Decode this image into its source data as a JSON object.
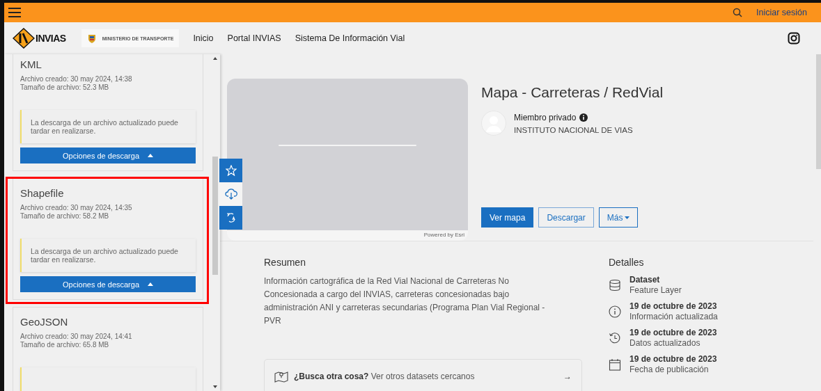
{
  "top_bar": {
    "sign_in": "Iniciar sesión"
  },
  "nav": {
    "logo_text": "INVIAS",
    "ministry": "MINISTERIO DE TRANSPORTE",
    "links": [
      "Inicio",
      "Portal INVIAS",
      "Sistema De Información Vial"
    ]
  },
  "downloads": [
    {
      "format": "KML",
      "created": "Archivo creado: 30 may 2024, 14:38",
      "size": "Tamaño de archivo: 52.3 MB",
      "notice": "La descarga de un archivo actualizado puede tardar en realizarse.",
      "button": "Opciones de descarga",
      "highlighted": false
    },
    {
      "format": "Shapefile",
      "created": "Archivo creado: 30 may 2024, 14:35",
      "size": "Tamaño de archivo: 58.2 MB",
      "notice": "La descarga de un archivo actualizado puede tardar en realizarse.",
      "button": "Opciones de descarga",
      "highlighted": true
    },
    {
      "format": "GeoJSON",
      "created": "Archivo creado: 30 may 2024, 14:41",
      "size": "Tamaño de archivo: 65.8 MB",
      "highlighted": false
    }
  ],
  "side_actions": [
    {
      "kind": "favorite",
      "selected": false
    },
    {
      "kind": "download",
      "selected": true
    },
    {
      "kind": "translate",
      "selected": false
    }
  ],
  "map": {
    "credit": "Powered by Esri"
  },
  "item": {
    "title": "Mapa - Carreteras / RedVial",
    "owner_label": "Miembro privado",
    "owner_org": "INSTITUTO NACIONAL DE VIAS",
    "buttons": [
      {
        "label": "Ver mapa",
        "kind": "primary"
      },
      {
        "label": "Descargar",
        "kind": "outline"
      },
      {
        "label": "Más",
        "kind": "dropdown"
      }
    ]
  },
  "summary": {
    "heading": "Resumen",
    "text": "Información cartográfica de la Red Vial Nacional de Carreteras No Concesionada a cargo del INVIAS, carreteras concesionadas bajo administración ANI y carreteras secundarias (Programa Plan Vial Regional - PVR",
    "search_prompt": "**¿Busca otra cosa?** Ver otros datasets cercanos",
    "arrow": "→"
  },
  "details": {
    "heading": "Detalles",
    "entries": [
      {
        "kind": "dataset",
        "title": "Dataset",
        "subtitle": "Feature Layer"
      },
      {
        "kind": "info",
        "title": "19 de octubre de 2023",
        "subtitle": "Información actualizada"
      },
      {
        "kind": "history",
        "title": "19 de octubre de 2023",
        "subtitle": "Datos actualizados"
      },
      {
        "kind": "calendar",
        "title": "19 de octubre de 2023",
        "subtitle": "Fecha de publicación"
      }
    ]
  }
}
